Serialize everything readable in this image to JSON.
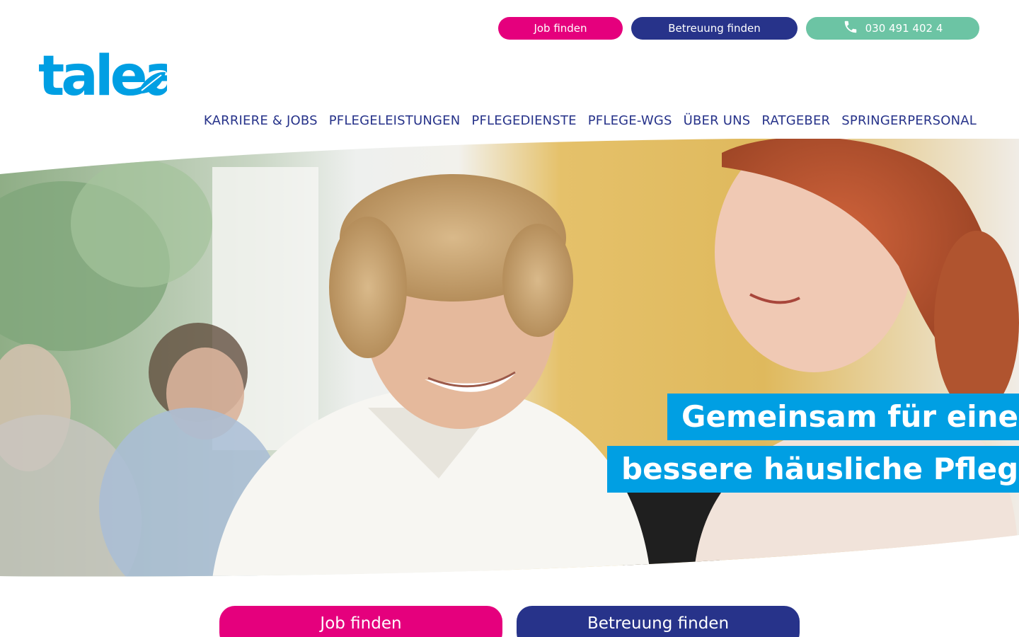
{
  "header": {
    "buttons": {
      "job": "Job finden",
      "care": "Betreuung finden",
      "phone": "030 491 402 4"
    },
    "logo_text": "talea"
  },
  "nav": {
    "items": [
      "KARRIERE & JOBS",
      "PFLEGELEISTUNGEN",
      "PFLEGEDIENSTE",
      "PFLEGE-WGS",
      "ÜBER UNS",
      "RATGEBER",
      "SPRINGERPERSONAL"
    ]
  },
  "hero": {
    "headline_line1": "Gemeinsam für eine",
    "headline_line2": "bessere häusliche Pflege"
  },
  "cta": {
    "job": "Job finden",
    "care": "Betreuung finden"
  },
  "colors": {
    "magenta": "#e5007d",
    "navy": "#27338a",
    "mint": "#6cc4a4",
    "brand_blue": "#009fe3"
  },
  "icons": {
    "phone": "phone-icon",
    "logo_leaf": "leaf-icon"
  }
}
